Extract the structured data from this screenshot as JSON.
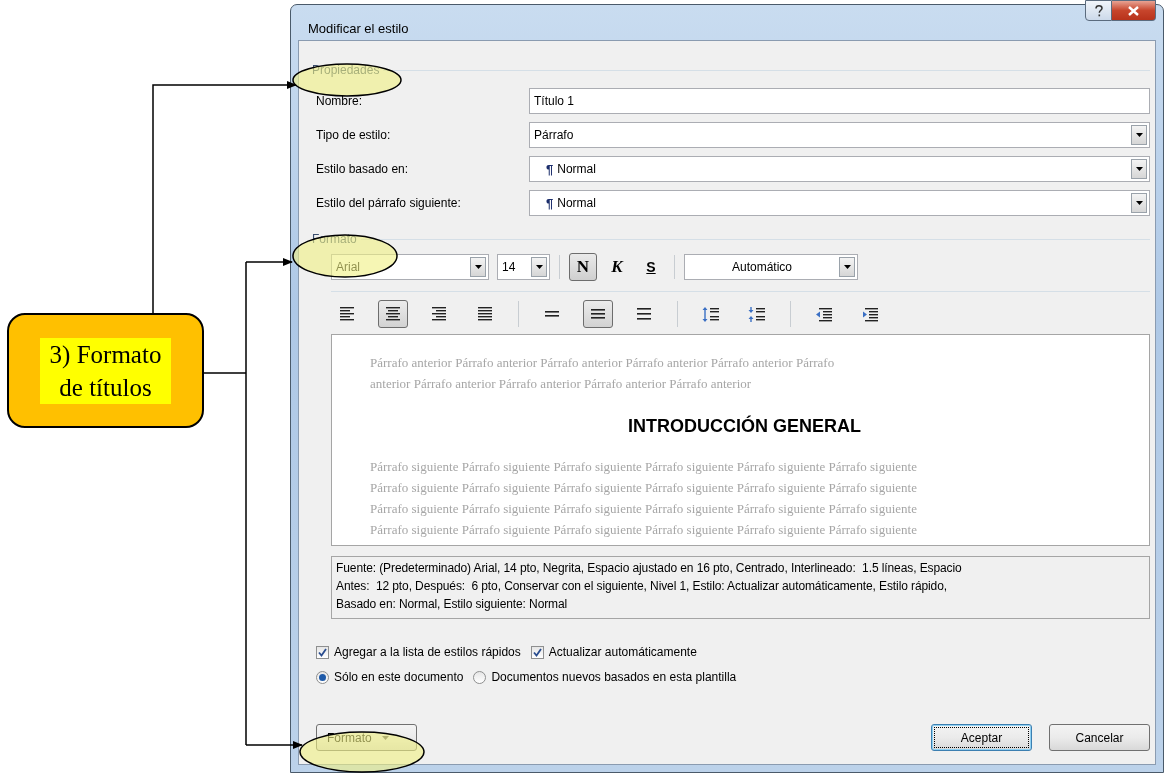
{
  "annotation": {
    "lines": [
      "3) Formato",
      "de títulos"
    ]
  },
  "dialog": {
    "title": "Modificar el estilo",
    "properties": {
      "legend": "Propiedades",
      "fields": [
        {
          "label": "Nombre:",
          "kind": "text",
          "value": "Título 1"
        },
        {
          "label": "Tipo de estilo:",
          "kind": "dropdown",
          "value": "Párrafo"
        },
        {
          "label": "Estilo basado en:",
          "kind": "dropdown",
          "mark": "¶",
          "value": "Normal"
        },
        {
          "label": "Estilo del párrafo siguiente:",
          "kind": "dropdown",
          "mark": "¶",
          "value": "Normal"
        }
      ]
    },
    "format": {
      "legend": "Formato",
      "font": "Arial",
      "size": "14",
      "styles": [
        {
          "label": "N",
          "kind": "bold",
          "selected": true
        },
        {
          "label": "K",
          "kind": "italic",
          "selected": false
        },
        {
          "label": "S",
          "kind": "underline",
          "selected": false
        }
      ],
      "font_color_label": "Automático",
      "alignment": [
        {
          "kind": "left",
          "selected": false
        },
        {
          "kind": "center",
          "selected": true
        },
        {
          "kind": "right",
          "selected": false
        },
        {
          "kind": "justify",
          "selected": false
        }
      ],
      "spacing": [
        {
          "kind": "single",
          "selected": false
        },
        {
          "kind": "one-half",
          "selected": true
        },
        {
          "kind": "double",
          "selected": false
        }
      ]
    },
    "preview": {
      "before_lines": [
        "Párrafo anterior Párrafo anterior Párrafo anterior Párrafo anterior Párrafo anterior Párrafo",
        "anterior Párrafo anterior Párrafo anterior Párrafo anterior Párrafo anterior"
      ],
      "heading": "INTRODUCCIÓN GENERAL",
      "after_lines": [
        "Párrafo siguiente Párrafo siguiente Párrafo siguiente Párrafo siguiente Párrafo siguiente Párrafo siguiente",
        "Párrafo siguiente Párrafo siguiente Párrafo siguiente Párrafo siguiente Párrafo siguiente Párrafo siguiente",
        "Párrafo siguiente Párrafo siguiente Párrafo siguiente Párrafo siguiente Párrafo siguiente Párrafo siguiente",
        "Párrafo siguiente Párrafo siguiente Párrafo siguiente Párrafo siguiente Párrafo siguiente Párrafo siguiente"
      ]
    },
    "description_lines": [
      "Fuente: (Predeterminado) Arial, 14 pto, Negrita, Espacio ajustado en 16 pto, Centrado, Interlineado:  1.5 líneas, Espacio",
      "Antes:  12 pto, Después:  6 pto, Conservar con el siguiente, Nivel 1, Estilo: Actualizar automáticamente, Estilo rápido,",
      "Basado en: Normal, Estilo siguiente: Normal"
    ],
    "checkboxes": [
      {
        "label": "Agregar a la lista de estilos rápidos",
        "checked": true
      },
      {
        "label": "Actualizar automáticamente",
        "checked": true
      }
    ],
    "radios": [
      {
        "label": "Sólo en este documento",
        "selected": true
      },
      {
        "label": "Documentos nuevos basados en esta plantilla",
        "selected": false
      }
    ],
    "buttons": [
      {
        "label": "Formato",
        "kind": "menu"
      },
      {
        "label": "Aceptar",
        "kind": "default"
      },
      {
        "label": "Cancelar",
        "kind": "normal"
      }
    ]
  }
}
